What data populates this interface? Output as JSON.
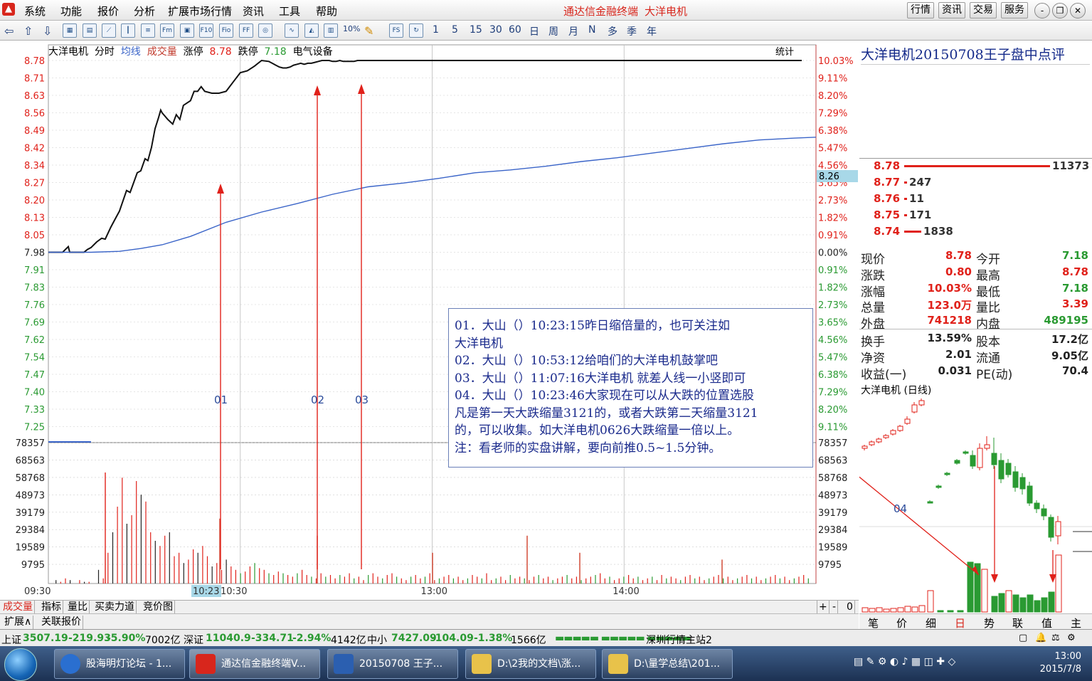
{
  "menu": {
    "items": [
      "系统",
      "功能",
      "报价",
      "分析",
      "扩展市场行情",
      "资讯",
      "工具",
      "帮助"
    ],
    "app_title": "通达信金融终端",
    "stock_title": "大洋电机",
    "top_buttons": [
      "行情",
      "资讯",
      "交易",
      "服务"
    ],
    "window_buttons": [
      "-",
      "❐",
      "✕"
    ]
  },
  "toolbar": {
    "icon_labels": [
      "Fm",
      "Fio",
      "F10",
      "FF",
      "FS"
    ],
    "period_buttons": [
      "1",
      "5",
      "15",
      "30",
      "60",
      "日",
      "周",
      "月",
      "N",
      "多",
      "季",
      "年"
    ],
    "percent_label": "10%"
  },
  "chart_header": {
    "name": "大洋电机",
    "mode": "分时",
    "avg_line": "均线",
    "volume": "成交量",
    "limit_up_label": "涨停",
    "limit_up_value": "8.78",
    "limit_down_label": "跌停",
    "limit_down_value": "7.18",
    "sector": "电气设备",
    "stat_button": "统计"
  },
  "chart_data": {
    "type": "line",
    "x_ticks": [
      "09:30",
      "10:23",
      "10:30",
      "13:00",
      "14:00"
    ],
    "price_ticks": [
      "8.78",
      "8.71",
      "8.63",
      "8.56",
      "8.49",
      "8.42",
      "8.34",
      "8.27",
      "8.20",
      "8.13",
      "8.05",
      "7.98",
      "7.91",
      "7.83",
      "7.76",
      "7.69",
      "7.62",
      "7.54",
      "7.47",
      "7.40",
      "7.33",
      "7.25"
    ],
    "pct_ticks": [
      "10.03%",
      "9.11%",
      "8.20%",
      "7.29%",
      "6.38%",
      "5.47%",
      "4.56%",
      "3.65%",
      "2.73%",
      "1.82%",
      "0.91%",
      "0.00%",
      "0.91%",
      "1.82%",
      "2.73%",
      "3.65%",
      "4.56%",
      "5.47%",
      "6.38%",
      "7.29%",
      "8.20%",
      "9.11%"
    ],
    "vol_ticks": [
      "78357",
      "68563",
      "58768",
      "48973",
      "39179",
      "29384",
      "19589",
      "9795"
    ],
    "ylim": [
      7.18,
      8.78
    ],
    "prev_close": 7.98,
    "crosshair_price": "8.26",
    "price_series": {
      "t": [
        0,
        20,
        28,
        30,
        33,
        36,
        50,
        55,
        60,
        68,
        75,
        80,
        88,
        95,
        100,
        110,
        115,
        125,
        130,
        136,
        140,
        145,
        150,
        155,
        158,
        160,
        168,
        175,
        180,
        185,
        190,
        200,
        205,
        210,
        215,
        220,
        230,
        240,
        250,
        260,
        270,
        280,
        290,
        300,
        310,
        315,
        320,
        325,
        330,
        335,
        340,
        345,
        350,
        355,
        360,
        365,
        370,
        375,
        380,
        385,
        390,
        395,
        400,
        405,
        410,
        415,
        420,
        425,
        430,
        435,
        440,
        445,
        450,
        455,
        460,
        465,
        470,
        475,
        480,
        490,
        500,
        510,
        520,
        530,
        540,
        550,
        560,
        570,
        580,
        590,
        600,
        610,
        620,
        630,
        640,
        650,
        660,
        670,
        680,
        690,
        700,
        710,
        720,
        730,
        740,
        750,
        760,
        770,
        780,
        790,
        800,
        810,
        820,
        830,
        840,
        850,
        860,
        870,
        880,
        890,
        900,
        910,
        920,
        930,
        940,
        950,
        960,
        970,
        980,
        990,
        1000,
        1010,
        1020,
        1030,
        1040,
        1050,
        1060,
        1070,
        1080
      ],
      "p": [
        7.98,
        7.98,
        8.04,
        7.98,
        7.98,
        7.98,
        7.98,
        8.01,
        8.03,
        8.09,
        8.13,
        8.12,
        8.25,
        8.35,
        8.42,
        8.64,
        8.62,
        8.83,
        8.85,
        8.98,
        8.96,
        9.1,
        9.3,
        9.42,
        9.5,
        9.47,
        9.4,
        9.35,
        9.45,
        9.4,
        9.55,
        9.6,
        9.7,
        9.7,
        9.75,
        9.7,
        9.68,
        9.68,
        9.7,
        9.8,
        9.9,
        9.92,
        9.97,
        10.03,
        10.02,
        10.0,
        9.98,
        9.96,
        9.95,
        9.95,
        9.96,
        9.98,
        9.99,
        10.0,
        9.99,
        10.0,
        10.0,
        10.01,
        10.02,
        10.03,
        10.03,
        10.03,
        10.02,
        10.02,
        10.03,
        10.02,
        10.02,
        10.02,
        10.02,
        10.03,
        10.03,
        10.03,
        10.03,
        10.03,
        10.03,
        10.03,
        10.03,
        10.03,
        10.03,
        10.03,
        10.03,
        10.03,
        10.03,
        10.03,
        10.03,
        10.03,
        10.03,
        10.03,
        10.03,
        10.03,
        10.03,
        10.03,
        10.03,
        10.03,
        10.03,
        10.03,
        10.03,
        10.03,
        10.03,
        10.03,
        10.03,
        10.03,
        10.03,
        10.03,
        10.03,
        10.03,
        10.03,
        10.03,
        10.03,
        10.03,
        10.03,
        10.03,
        10.03,
        10.03,
        10.03,
        10.03,
        10.03,
        10.03,
        10.03,
        10.03,
        10.03,
        10.03,
        10.03,
        10.03,
        10.03,
        10.03,
        10.03,
        10.03,
        10.03,
        10.03,
        10.03,
        10.03,
        10.03,
        10.03,
        10.03,
        10.03,
        10.03
      ]
    },
    "avg_series": {
      "t": [
        0,
        60,
        100,
        130,
        160,
        200,
        250,
        300,
        350,
        400,
        450,
        500,
        550,
        600,
        650,
        700,
        750,
        800,
        850,
        900,
        950,
        1000,
        1050,
        1080
      ],
      "p": [
        7.98,
        7.98,
        7.99,
        8.02,
        8.06,
        8.15,
        8.3,
        8.41,
        8.5,
        8.6,
        8.68,
        8.72,
        8.77,
        8.83,
        8.86,
        8.9,
        8.95,
        8.99,
        9.04,
        9.09,
        9.14,
        9.18,
        9.2,
        9.21
      ]
    },
    "volume_series": [
      0,
      2,
      1,
      3,
      2,
      0,
      2,
      1,
      1,
      0,
      8,
      3,
      18,
      30,
      45,
      62,
      35,
      40,
      60,
      52,
      48,
      30,
      25,
      22,
      28,
      30,
      16,
      18,
      12,
      14,
      20,
      18,
      22,
      16,
      10,
      12,
      8,
      14,
      10,
      8,
      6,
      7,
      10,
      12,
      9,
      8,
      6,
      5,
      7,
      6,
      5,
      4,
      6,
      8,
      5,
      4,
      3,
      6,
      4,
      5,
      3,
      5,
      4,
      6,
      3,
      4,
      2,
      5,
      6,
      4,
      3,
      5,
      6,
      4,
      3,
      2,
      4,
      5,
      3,
      4,
      6,
      2,
      3,
      4,
      5,
      3,
      4,
      2,
      3,
      5,
      4,
      3,
      6,
      2,
      3,
      4,
      2,
      5,
      3,
      4,
      3,
      2,
      4,
      5,
      3,
      4,
      2,
      3,
      4,
      5,
      3,
      4,
      2,
      3,
      4,
      5,
      6,
      3,
      4,
      2,
      3,
      4,
      5,
      3,
      4,
      2,
      3,
      4,
      2,
      5,
      3,
      4,
      3,
      2,
      4,
      5,
      3,
      4,
      2,
      3,
      4,
      5,
      3,
      4,
      2,
      3,
      4,
      5,
      3,
      4,
      2,
      3,
      4,
      5,
      3,
      4,
      2,
      3,
      4,
      5,
      3
    ],
    "markers": [
      {
        "label": "01",
        "price": 8.25
      },
      {
        "label": "02",
        "price": 8.73
      },
      {
        "label": "03",
        "price": 8.71
      }
    ]
  },
  "annotation": {
    "lines": [
      "01．大山（）10:23:15昨日缩倍量的，也可关注如",
      "大洋电机",
      "02．大山（）10:53:12给咱们的大洋电机鼓掌吧",
      "03．大山（）11:07:16大洋电机  就差人线一小竖即可",
      "04．大山（）10:23:46大家现在可以从大跌的位置选股",
      "凡是第一天大跌缩量3121的，或者大跌第二天缩量3121",
      "的，可以收集。如大洋电机0626大跌缩量一倍以上。",
      "注：看老师的实盘讲解，要向前推0.5~1.5分钟。"
    ]
  },
  "right_panel": {
    "title": "大洋电机20150708王子盘中点评",
    "orderbook": [
      {
        "price": "8.78",
        "vol": "11373"
      },
      {
        "price": "8.77",
        "vol": "247"
      },
      {
        "price": "8.76",
        "vol": "11"
      },
      {
        "price": "8.75",
        "vol": "171"
      },
      {
        "price": "8.74",
        "vol": "1838"
      }
    ],
    "quotes": [
      {
        "l1": "现价",
        "v1": "8.78",
        "l2": "今开",
        "v2": "7.18"
      },
      {
        "l1": "涨跌",
        "v1": "0.80",
        "l2": "最高",
        "v2": "8.78"
      },
      {
        "l1": "涨幅",
        "v1": "10.03%",
        "l2": "最低",
        "v2": "7.18"
      },
      {
        "l1": "总量",
        "v1": "123.0万",
        "l2": "量比",
        "v2": "3.39"
      },
      {
        "l1": "外盘",
        "v1": "741218",
        "l2": "内盘",
        "v2": "489195"
      },
      {
        "l1": "换手",
        "v1": "13.59%",
        "l2": "股本",
        "v2": "17.2亿"
      },
      {
        "l1": "净资",
        "v1": "2.01",
        "l2": "流通",
        "v2": "9.05亿"
      },
      {
        "l1": "收益(一)",
        "v1": "0.031",
        "l2": "PE(动)",
        "v2": "70.4"
      }
    ],
    "kline_title": "大洋电机 (日线)",
    "kline_marker": "04",
    "tabs": [
      "笔",
      "价",
      "细",
      "日",
      "势",
      "联",
      "值",
      "主"
    ]
  },
  "bottom_tabs": [
    "成交量",
    "指标",
    "量比",
    "买卖力道",
    "竞价图"
  ],
  "bottom_controls": [
    "+",
    "-",
    "0"
  ],
  "subbar": [
    "扩展∧",
    "关联报价"
  ],
  "statusbar": {
    "sh_label": "上证",
    "sh_index": "3507.19",
    "sh_change": "-219.93",
    "sh_pct": "-5.90%",
    "sh_amount": "7002亿",
    "sz_label": "深证",
    "sz_index": "11040.9",
    "sz_change": "-334.71",
    "sz_pct": "-2.94%",
    "sz_amount": "4142亿",
    "zx_label": "中小",
    "zx_index": "7427.09",
    "zx_change": "-104.09",
    "zx_pct": "-1.38%",
    "zx_amount": "1566亿",
    "server": "深圳行情主站2"
  },
  "taskbar": {
    "items": [
      "股海明灯论坛 - 1...",
      "通达信金融终端V...",
      "20150708 王子...",
      "D:\\2我的文档\\涨...",
      "D:\\量学总结\\201..."
    ],
    "time": "13:00",
    "date": "2015/7/8"
  },
  "colors": {
    "up": "#e0211a",
    "down": "#2a9a32",
    "price_line": "#111111",
    "avg_line": "#3a64c8",
    "annotation_text": "#1a2a8c"
  }
}
